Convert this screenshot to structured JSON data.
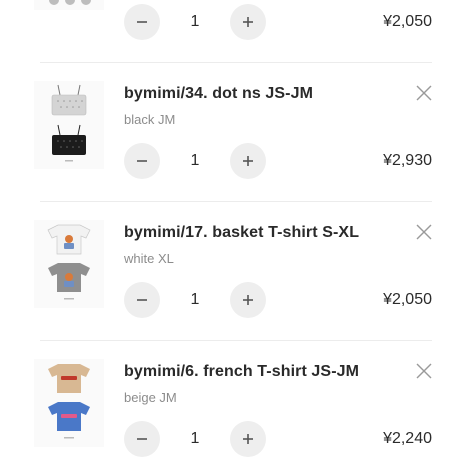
{
  "cart": {
    "partial_item": {
      "quantity": "1",
      "price": "¥2,050"
    },
    "items": [
      {
        "title": "bymimi/34. dot ns JS-JM",
        "variant": "black JM",
        "quantity": "1",
        "price": "¥2,930",
        "image": "camisole-tops-icon"
      },
      {
        "title": "bymimi/17. basket T-shirt S-XL",
        "variant": "white XL",
        "quantity": "1",
        "price": "¥2,050",
        "image": "basket-tshirts-icon"
      },
      {
        "title": "bymimi/6. french T-shirt JS-JM",
        "variant": "beige JM",
        "quantity": "1",
        "price": "¥2,240",
        "image": "french-tshirts-icon"
      }
    ]
  },
  "colors": {
    "stepper_bg": "#eeeeee",
    "text": "#2b2b2b",
    "muted": "#8c8c8c",
    "divider": "#ececec"
  }
}
